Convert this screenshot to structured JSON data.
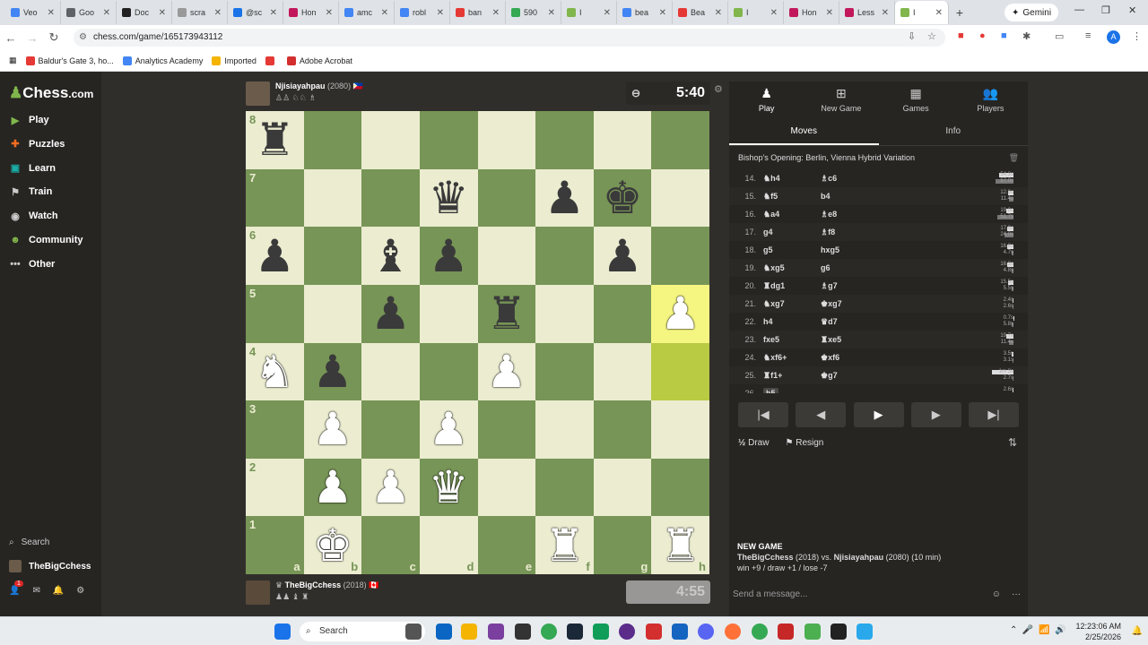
{
  "browser": {
    "tabs": [
      {
        "label": "Veo",
        "color": "#4285f4"
      },
      {
        "label": "Goo",
        "color": "#5f6368"
      },
      {
        "label": "Doc",
        "color": "#222222"
      },
      {
        "label": "scra",
        "color": "#999999"
      },
      {
        "label": "@sc",
        "color": "#1a73e8"
      },
      {
        "label": "Hon",
        "color": "#c2185b"
      },
      {
        "label": "amc",
        "color": "#4285f4"
      },
      {
        "label": "robl",
        "color": "#4285f4"
      },
      {
        "label": "ban",
        "color": "#e53935"
      },
      {
        "label": "590",
        "color": "#34a853"
      },
      {
        "label": "I",
        "color": "#81b64c"
      },
      {
        "label": "bea",
        "color": "#4285f4"
      },
      {
        "label": "Bea",
        "color": "#e53935"
      },
      {
        "label": "I",
        "color": "#81b64c"
      },
      {
        "label": "Hon",
        "color": "#c2185b"
      },
      {
        "label": "Less",
        "color": "#c2185b"
      },
      {
        "label": "I",
        "color": "#81b64c",
        "active": true
      }
    ],
    "new_tab": "+",
    "gemini": "Gemini",
    "url": "chess.com/game/165173943112",
    "bookmarks": [
      {
        "label": "Baldur's Gate 3, ho...",
        "color": "#e53935"
      },
      {
        "label": "Analytics Academy",
        "color": "#4285f4"
      },
      {
        "label": "Imported",
        "color": "#f4b400"
      },
      {
        "label": "",
        "color": "#e53935"
      },
      {
        "label": "Adobe Acrobat",
        "color": "#d32f2f"
      }
    ],
    "profile_initial": "A"
  },
  "sidebar": {
    "logo_prefix": "",
    "logo_main": "Chess",
    "logo_suffix": ".com",
    "items": [
      {
        "label": "Play",
        "icon": "play-icon"
      },
      {
        "label": "Puzzles",
        "icon": "puzzle-icon"
      },
      {
        "label": "Learn",
        "icon": "learn-icon"
      },
      {
        "label": "Train",
        "icon": "train-icon"
      },
      {
        "label": "Watch",
        "icon": "watch-icon"
      },
      {
        "label": "Community",
        "icon": "community-icon"
      },
      {
        "label": "Other",
        "icon": "more-icon"
      }
    ],
    "search": "Search",
    "username": "TheBigCchess",
    "notif_count": "1"
  },
  "game": {
    "top_player": {
      "name": "Njisiayahpau",
      "rating": "(2080)",
      "clock": "5:40"
    },
    "bottom_player": {
      "name": "TheBigCchess",
      "rating": "(2018)",
      "clock": "4:55"
    },
    "board": [
      [
        "r",
        "",
        "",
        "",
        "",
        "",
        "",
        ""
      ],
      [
        "",
        "",
        "",
        "q",
        "",
        "p",
        "k",
        ""
      ],
      [
        "p",
        "",
        "b",
        "p",
        "",
        "",
        "p",
        ""
      ],
      [
        "",
        "",
        "p",
        "",
        "r",
        "",
        "",
        "P"
      ],
      [
        "N",
        "p",
        "",
        "",
        "P",
        "",
        "",
        ""
      ],
      [
        "",
        "P",
        "",
        "P",
        "",
        "",
        "",
        ""
      ],
      [
        "",
        "P",
        "P",
        "Q",
        "",
        "",
        "",
        ""
      ],
      [
        "",
        "K",
        "",
        "",
        "",
        "R",
        "",
        "R"
      ]
    ],
    "highlight": [
      [
        3,
        7
      ],
      [
        4,
        7
      ]
    ],
    "ranks": [
      "8",
      "7",
      "6",
      "5",
      "4",
      "3",
      "2",
      "1"
    ],
    "files": [
      "a",
      "b",
      "c",
      "d",
      "e",
      "f",
      "g",
      "h"
    ]
  },
  "panel": {
    "tabs": [
      {
        "label": "Play",
        "icon": "pawn-icon"
      },
      {
        "label": "New Game",
        "icon": "plus-icon"
      },
      {
        "label": "Games",
        "icon": "grid-icon"
      },
      {
        "label": "Players",
        "icon": "players-icon"
      }
    ],
    "subtabs": [
      "Moves",
      "Info"
    ],
    "opening": "Bishop's Opening: Berlin, Vienna Hybrid Variation",
    "moves": [
      {
        "n": "14.",
        "w": "♞h4",
        "b": "♗c6",
        "wt": "54.3s",
        "bt": "57.0s",
        "wf": 0.4,
        "bf": 0.5
      },
      {
        "n": "15.",
        "w": "♞f5",
        "b": "b4",
        "wt": "12.9s",
        "bt": "11.4s",
        "wf": 0.15,
        "bf": 0.12
      },
      {
        "n": "16.",
        "w": "♞a4",
        "b": "♗e8",
        "wt": "19.0s",
        "bt": "51.7s",
        "wf": 0.2,
        "bf": 0.45
      },
      {
        "n": "17.",
        "w": "g4",
        "b": "♗f8",
        "wt": "17.0s",
        "bt": "24.0s",
        "wf": 0.18,
        "bf": 0.25
      },
      {
        "n": "18.",
        "w": "g5",
        "b": "hxg5",
        "wt": "16.8s",
        "bt": "4.7s",
        "wf": 0.17,
        "bf": 0.05
      },
      {
        "n": "19.",
        "w": "♞xg5",
        "b": "g6",
        "wt": "16.3s",
        "bt": "4.8s",
        "wf": 0.17,
        "bf": 0.05
      },
      {
        "n": "20.",
        "w": "♜dg1",
        "b": "♗g7",
        "wt": "15.5s",
        "bt": "5.5s",
        "wf": 0.16,
        "bf": 0.06
      },
      {
        "n": "21.",
        "w": "♞xg7",
        "b": "♚xg7",
        "wt": "2.4s",
        "bt": "2.6s",
        "wf": 0.03,
        "bf": 0.03
      },
      {
        "n": "22.",
        "w": "h4",
        "b": "♛d7",
        "wt": "0.7s",
        "bt": "5.8s",
        "wf": 0.01,
        "bf": 0.06
      },
      {
        "n": "23.",
        "w": "fxe5",
        "b": "♜xe5",
        "wt": "19.7s",
        "bt": "11.4s",
        "wf": 0.2,
        "bf": 0.12
      },
      {
        "n": "24.",
        "w": "♞xf6+",
        "b": "♚xf6",
        "wt": "3.5s",
        "bt": "3.1s",
        "wf": 0.04,
        "bf": 0.03
      },
      {
        "n": "25.",
        "w": "♜f1+",
        "b": "♚g7",
        "wt": "1m 3s",
        "bt": "2.7s",
        "wf": 0.6,
        "bf": 0.03
      },
      {
        "n": "26.",
        "w": "h5",
        "b": "",
        "wt": "2.6s",
        "bt": "",
        "wf": 0.03,
        "bf": 0,
        "current": true
      }
    ],
    "controls": [
      "|◀",
      "◀",
      "▶",
      "▶",
      "▶|"
    ],
    "draw": "Draw",
    "draw_icon": "½",
    "resign": "Resign",
    "new_game_header": "NEW GAME",
    "new_game_white": "TheBigCchess",
    "new_game_white_rating": "(2018)",
    "vs": "vs.",
    "new_game_black": "Njisiayahpau",
    "new_game_black_rating": "(2080)",
    "new_game_time": "(10 min)",
    "record": "win +9 / draw +1 / lose -7",
    "message_placeholder": "Send a message..."
  },
  "taskbar": {
    "search": "Search",
    "time": "12:23:06 AM",
    "date": "2/25/2026"
  }
}
